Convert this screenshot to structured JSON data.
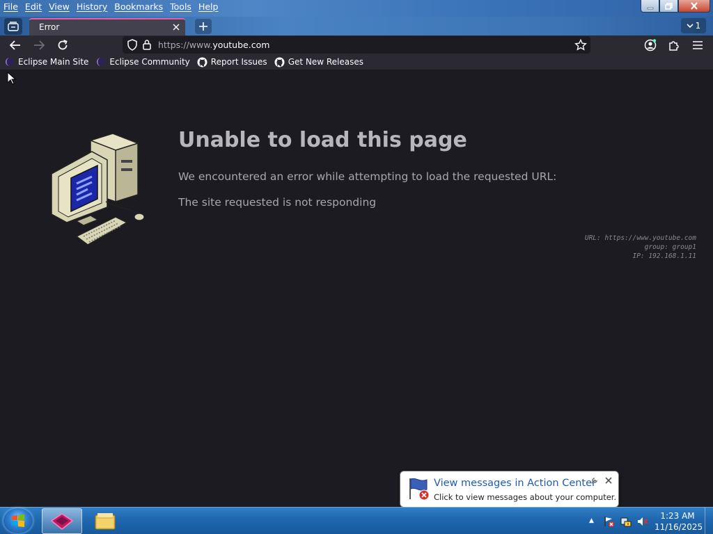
{
  "menu": [
    "File",
    "Edit",
    "View",
    "History",
    "Bookmarks",
    "Tools",
    "Help"
  ],
  "tab": {
    "title": "Error",
    "count": "1"
  },
  "url": {
    "prefix": "https://www.",
    "domain": "youtube.com"
  },
  "bookmarks": [
    {
      "label": "Eclipse Main Site",
      "icon": "eclipse-icon"
    },
    {
      "label": "Eclipse Community",
      "icon": "eclipse-icon"
    },
    {
      "label": "Report Issues",
      "icon": "github-icon"
    },
    {
      "label": "Get New Releases",
      "icon": "github-icon"
    }
  ],
  "error": {
    "title": "Unable to load this page",
    "description": "We encountered an error while attempting to load the requested URL:",
    "reason": "The site requested is not responding",
    "diagnostics": {
      "url": "URL: https://www.youtube.com",
      "group": "group: group1",
      "ip": "IP: 192.168.1.11"
    }
  },
  "notification": {
    "title": "View messages in Action Center",
    "subtitle": "Click to view messages about your computer."
  },
  "clock": {
    "time": "1:23 AM",
    "date": "11/16/2025"
  },
  "colors": {
    "tab_accent": "#e75fa8",
    "page_bg": "#1c1b22",
    "taskbar": "#1f67ae"
  }
}
